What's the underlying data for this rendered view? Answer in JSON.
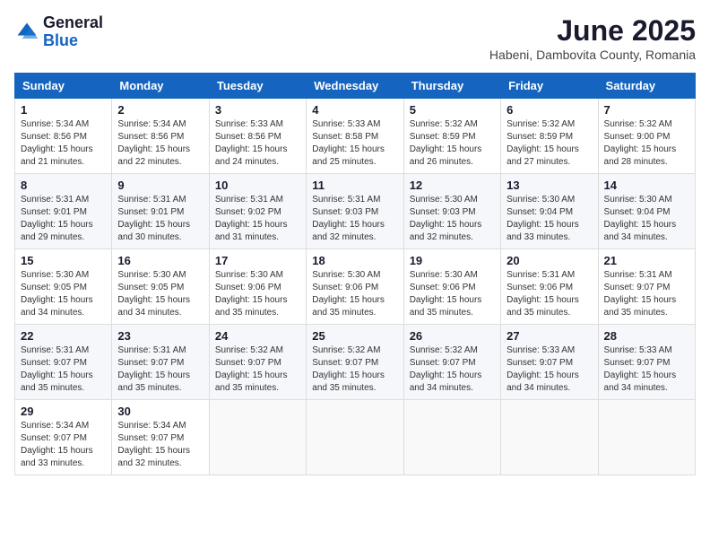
{
  "logo": {
    "general": "General",
    "blue": "Blue"
  },
  "title": "June 2025",
  "subtitle": "Habeni, Dambovita County, Romania",
  "headers": [
    "Sunday",
    "Monday",
    "Tuesday",
    "Wednesday",
    "Thursday",
    "Friday",
    "Saturday"
  ],
  "weeks": [
    [
      {
        "day": "1",
        "sunrise": "5:34 AM",
        "sunset": "8:56 PM",
        "daylight": "15 hours and 21 minutes."
      },
      {
        "day": "2",
        "sunrise": "5:34 AM",
        "sunset": "8:56 PM",
        "daylight": "15 hours and 22 minutes."
      },
      {
        "day": "3",
        "sunrise": "5:33 AM",
        "sunset": "8:56 PM",
        "daylight": "15 hours and 24 minutes."
      },
      {
        "day": "4",
        "sunrise": "5:33 AM",
        "sunset": "8:58 PM",
        "daylight": "15 hours and 25 minutes."
      },
      {
        "day": "5",
        "sunrise": "5:32 AM",
        "sunset": "8:59 PM",
        "daylight": "15 hours and 26 minutes."
      },
      {
        "day": "6",
        "sunrise": "5:32 AM",
        "sunset": "8:59 PM",
        "daylight": "15 hours and 27 minutes."
      },
      {
        "day": "7",
        "sunrise": "5:32 AM",
        "sunset": "9:00 PM",
        "daylight": "15 hours and 28 minutes."
      }
    ],
    [
      {
        "day": "8",
        "sunrise": "5:31 AM",
        "sunset": "9:01 PM",
        "daylight": "15 hours and 29 minutes."
      },
      {
        "day": "9",
        "sunrise": "5:31 AM",
        "sunset": "9:01 PM",
        "daylight": "15 hours and 30 minutes."
      },
      {
        "day": "10",
        "sunrise": "5:31 AM",
        "sunset": "9:02 PM",
        "daylight": "15 hours and 31 minutes."
      },
      {
        "day": "11",
        "sunrise": "5:31 AM",
        "sunset": "9:03 PM",
        "daylight": "15 hours and 32 minutes."
      },
      {
        "day": "12",
        "sunrise": "5:30 AM",
        "sunset": "9:03 PM",
        "daylight": "15 hours and 32 minutes."
      },
      {
        "day": "13",
        "sunrise": "5:30 AM",
        "sunset": "9:04 PM",
        "daylight": "15 hours and 33 minutes."
      },
      {
        "day": "14",
        "sunrise": "5:30 AM",
        "sunset": "9:04 PM",
        "daylight": "15 hours and 34 minutes."
      }
    ],
    [
      {
        "day": "15",
        "sunrise": "5:30 AM",
        "sunset": "9:05 PM",
        "daylight": "15 hours and 34 minutes."
      },
      {
        "day": "16",
        "sunrise": "5:30 AM",
        "sunset": "9:05 PM",
        "daylight": "15 hours and 34 minutes."
      },
      {
        "day": "17",
        "sunrise": "5:30 AM",
        "sunset": "9:06 PM",
        "daylight": "15 hours and 35 minutes."
      },
      {
        "day": "18",
        "sunrise": "5:30 AM",
        "sunset": "9:06 PM",
        "daylight": "15 hours and 35 minutes."
      },
      {
        "day": "19",
        "sunrise": "5:30 AM",
        "sunset": "9:06 PM",
        "daylight": "15 hours and 35 minutes."
      },
      {
        "day": "20",
        "sunrise": "5:31 AM",
        "sunset": "9:06 PM",
        "daylight": "15 hours and 35 minutes."
      },
      {
        "day": "21",
        "sunrise": "5:31 AM",
        "sunset": "9:07 PM",
        "daylight": "15 hours and 35 minutes."
      }
    ],
    [
      {
        "day": "22",
        "sunrise": "5:31 AM",
        "sunset": "9:07 PM",
        "daylight": "15 hours and 35 minutes."
      },
      {
        "day": "23",
        "sunrise": "5:31 AM",
        "sunset": "9:07 PM",
        "daylight": "15 hours and 35 minutes."
      },
      {
        "day": "24",
        "sunrise": "5:32 AM",
        "sunset": "9:07 PM",
        "daylight": "15 hours and 35 minutes."
      },
      {
        "day": "25",
        "sunrise": "5:32 AM",
        "sunset": "9:07 PM",
        "daylight": "15 hours and 35 minutes."
      },
      {
        "day": "26",
        "sunrise": "5:32 AM",
        "sunset": "9:07 PM",
        "daylight": "15 hours and 34 minutes."
      },
      {
        "day": "27",
        "sunrise": "5:33 AM",
        "sunset": "9:07 PM",
        "daylight": "15 hours and 34 minutes."
      },
      {
        "day": "28",
        "sunrise": "5:33 AM",
        "sunset": "9:07 PM",
        "daylight": "15 hours and 34 minutes."
      }
    ],
    [
      {
        "day": "29",
        "sunrise": "5:34 AM",
        "sunset": "9:07 PM",
        "daylight": "15 hours and 33 minutes."
      },
      {
        "day": "30",
        "sunrise": "5:34 AM",
        "sunset": "9:07 PM",
        "daylight": "15 hours and 32 minutes."
      },
      null,
      null,
      null,
      null,
      null
    ]
  ]
}
